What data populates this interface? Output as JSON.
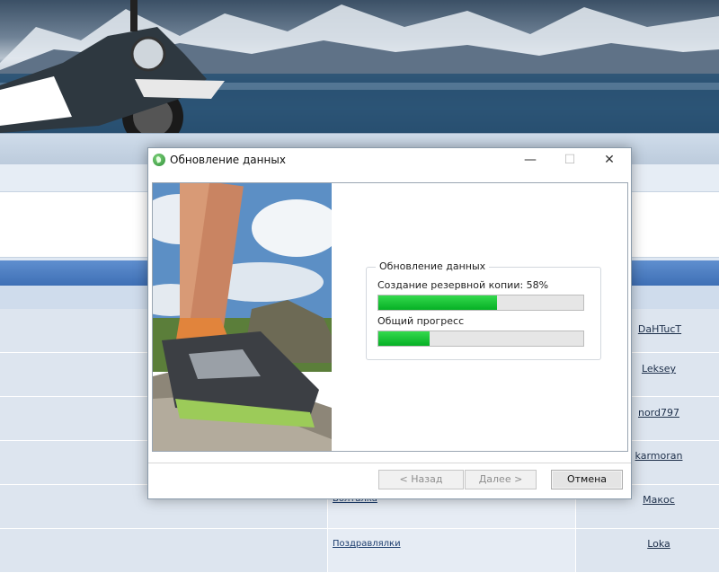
{
  "dialog": {
    "title": "Обновление данных",
    "window_controls": {
      "minimize": "—",
      "maximize": "☐",
      "close": "✕"
    },
    "group_title": "Обновление данных",
    "backup": {
      "label": "Создание резервной копии: 58%",
      "progress": 0.58
    },
    "overall": {
      "label": "Общий прогресс",
      "progress": 0.25
    },
    "buttons": {
      "back": "< Назад",
      "next": "Далее >",
      "cancel": "Отмена"
    },
    "accent_color": "#06b025"
  },
  "forum": {
    "rows": [
      {
        "forum": "",
        "user": "DaHTucT"
      },
      {
        "forum": "",
        "user": "Leksey"
      },
      {
        "forum": "",
        "user": "nord797"
      },
      {
        "forum": "",
        "user": "karmoran"
      },
      {
        "forum": "Болталка",
        "user": "Макос"
      },
      {
        "forum": "Поздравлялки",
        "user": "Loka"
      }
    ]
  }
}
